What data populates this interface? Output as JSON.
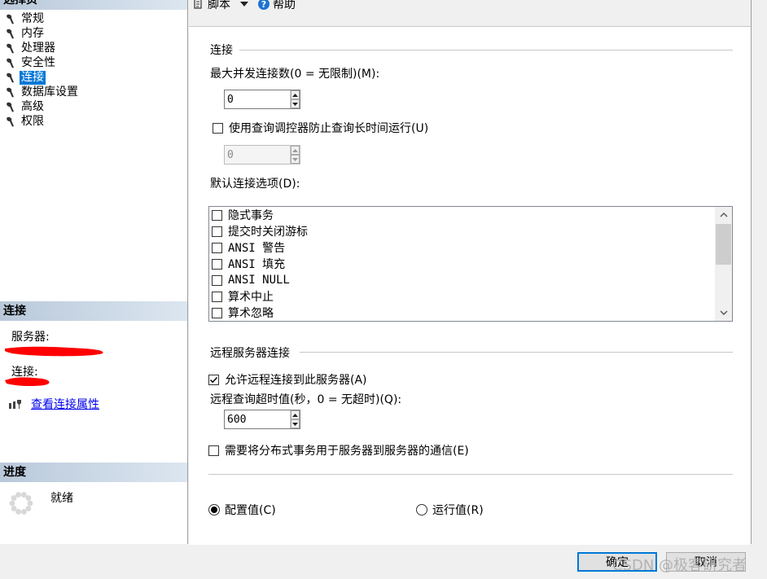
{
  "left_pane": {
    "select_page_title": "选择页",
    "pages": [
      {
        "label": "常规"
      },
      {
        "label": "内存"
      },
      {
        "label": "处理器"
      },
      {
        "label": "安全性"
      },
      {
        "label": "连接",
        "selected": true
      },
      {
        "label": "数据库设置"
      },
      {
        "label": "高级"
      },
      {
        "label": "权限"
      }
    ],
    "connection_section": {
      "title": "连接",
      "server_label": "服务器:",
      "connection_label": "连接:",
      "view_properties_link": "查看连接属性"
    },
    "progress_section": {
      "title": "进度",
      "status": "就绪"
    }
  },
  "toolbar": {
    "script_label": "脚本",
    "help_label": "帮助"
  },
  "connections": {
    "group_title": "连接",
    "max_concurrent_label": "最大并发连接数(0 = 无限制)(M):",
    "max_concurrent_value": "0",
    "query_governor_label": "使用查询调控器防止查询长时间运行(U)",
    "query_governor_checked": false,
    "query_governor_value": "0",
    "default_options_label": "默认连接选项(D):",
    "default_options": [
      {
        "label": "隐式事务",
        "checked": false
      },
      {
        "label": "提交时关闭游标",
        "checked": false
      },
      {
        "label": "ANSI 警告",
        "checked": false
      },
      {
        "label": "ANSI 填充",
        "checked": false
      },
      {
        "label": "ANSI NULL",
        "checked": false
      },
      {
        "label": "算术中止",
        "checked": false
      },
      {
        "label": "算术忽略",
        "checked": false
      }
    ]
  },
  "remote": {
    "group_title": "远程服务器连接",
    "allow_remote_label": "允许远程连接到此服务器(A)",
    "allow_remote_checked": true,
    "timeout_label": "远程查询超时值(秒，0 = 无超时)(Q):",
    "timeout_value": "600",
    "distributed_tx_label": "需要将分布式事务用于服务器到服务器的通信(E)",
    "distributed_tx_checked": false
  },
  "value_mode": {
    "configured_label": "配置值(C)",
    "running_label": "运行值(R)",
    "selected": "configured"
  },
  "buttons": {
    "ok_label": "确定",
    "cancel_label": "取消"
  },
  "watermark": "CSDN @极客研究者",
  "colors": {
    "selection": "#0078d7",
    "link": "#0000ee",
    "section_header_start": "#b9c9da",
    "section_header_end": "#dce6f0",
    "redaction": "#ff0000"
  }
}
